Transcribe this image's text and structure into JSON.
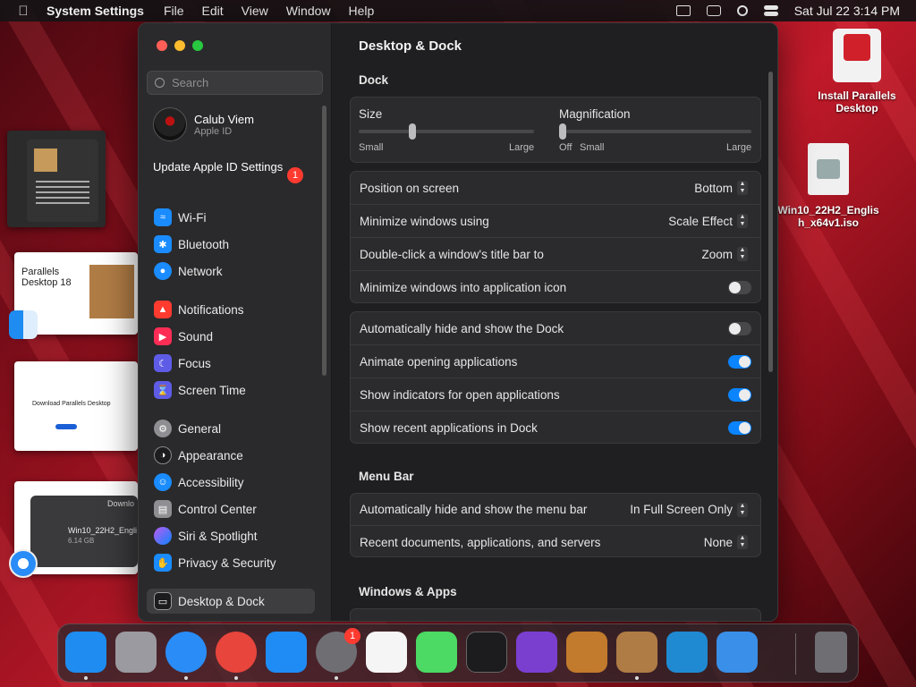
{
  "menubar": {
    "app": "System Settings",
    "items": [
      "File",
      "Edit",
      "View",
      "Window",
      "Help"
    ],
    "clock": "Sat Jul 22  3:14 PM"
  },
  "desktop": {
    "parallels_label": "Install Parallels Desktop",
    "iso_label": "Win10_22H2_English_x64v1.iso",
    "thumb2_text": "Parallels\nDesktop 18",
    "thumb3_text": "Download Parallels Desktop",
    "thumb4_title": "Downlo",
    "thumb4_file": "Win10_22H2_Engli",
    "thumb4_size": "6.14 GB"
  },
  "sidebar": {
    "search_placeholder": "Search",
    "user_name": "Calub Viem",
    "user_sub": "Apple ID",
    "update_label": "Update Apple ID Settings",
    "update_badge": "1",
    "items": [
      {
        "label": "Wi-Fi",
        "color": "#1a8cff"
      },
      {
        "label": "Bluetooth",
        "color": "#1a8cff"
      },
      {
        "label": "Network",
        "color": "#1a8cff"
      },
      {
        "label": "Notifications",
        "color": "#ff3b30"
      },
      {
        "label": "Sound",
        "color": "#ff2d55"
      },
      {
        "label": "Focus",
        "color": "#5e5ce6"
      },
      {
        "label": "Screen Time",
        "color": "#5e5ce6"
      },
      {
        "label": "General",
        "color": "#8e8e93"
      },
      {
        "label": "Appearance",
        "color": "#1c1c1e"
      },
      {
        "label": "Accessibility",
        "color": "#1a8cff"
      },
      {
        "label": "Control Center",
        "color": "#8e8e93"
      },
      {
        "label": "Siri & Spotlight",
        "color": "#bf5af2"
      },
      {
        "label": "Privacy & Security",
        "color": "#1a8cff"
      },
      {
        "label": "Desktop & Dock",
        "color": "#1c1c1e"
      }
    ]
  },
  "main": {
    "title": "Desktop & Dock",
    "dock_head": "Dock",
    "size_label": "Size",
    "size_small": "Small",
    "size_large": "Large",
    "mag_label": "Magnification",
    "mag_off": "Off",
    "mag_small": "Small",
    "mag_large": "Large",
    "size_value": 0.3,
    "mag_value": 0,
    "group1": [
      {
        "label": "Position on screen",
        "value": "Bottom"
      },
      {
        "label": "Minimize windows using",
        "value": "Scale Effect"
      },
      {
        "label": "Double-click a window's title bar to",
        "value": "Zoom"
      },
      {
        "label": "Minimize windows into application icon",
        "toggle": false
      }
    ],
    "group2": [
      {
        "label": "Automatically hide and show the Dock",
        "toggle": false
      },
      {
        "label": "Animate opening applications",
        "toggle": true
      },
      {
        "label": "Show indicators for open applications",
        "toggle": true
      },
      {
        "label": "Show recent applications in Dock",
        "toggle": true
      }
    ],
    "menubar_head": "Menu Bar",
    "group3": [
      {
        "label": "Automatically hide and show the menu bar",
        "value": "In Full Screen Only"
      },
      {
        "label": "Recent documents, applications, and servers",
        "value": "None"
      }
    ],
    "windows_head": "Windows & Apps"
  },
  "dock": {
    "settings_badge": "1",
    "apps": [
      {
        "name": "Finder",
        "color": "#1e8cf0"
      },
      {
        "name": "Launchpad",
        "color": "#9a9aa0"
      },
      {
        "name": "Safari",
        "color": "#2a8cf6"
      },
      {
        "name": "Chrome",
        "color": "#e8453c"
      },
      {
        "name": "App Store",
        "color": "#1f8cf5"
      },
      {
        "name": "System Settings",
        "color": "#6e6e73"
      },
      {
        "name": "TextEdit",
        "color": "#f5f5f5"
      },
      {
        "name": "Maps",
        "color": "#4cd964"
      },
      {
        "name": "Terminal",
        "color": "#1c1c1e"
      },
      {
        "name": "Visual Studio",
        "color": "#7b3fd0"
      },
      {
        "name": "GarageBand",
        "color": "#c27a2c"
      },
      {
        "name": "Parallels Installer",
        "color": "#b07c45"
      },
      {
        "name": "VS Code",
        "color": "#1f8ad2"
      },
      {
        "name": "Weather",
        "color": "#3a8fe8"
      }
    ]
  }
}
